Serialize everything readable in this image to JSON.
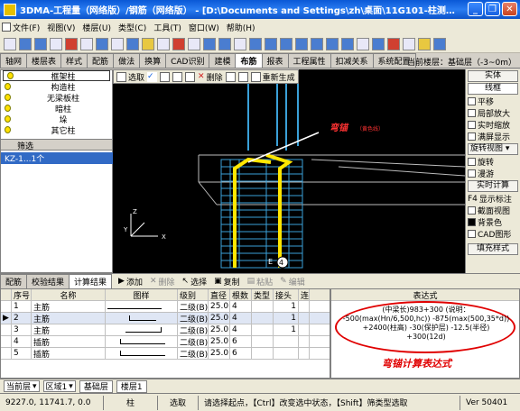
{
  "window": {
    "title": "3DMA-工程量（网络版）/钢筋（网络版） - [D:\\Documents and Settings\\zh\\桌面\\11G101-柱测…"
  },
  "menu": [
    "文件(F)",
    "视图(V)",
    "楼层(U)",
    "类型(C)",
    "工具(T)",
    "窗口(W)",
    "帮助(H)"
  ],
  "tabs": [
    "轴网",
    "楼层表",
    "样式",
    "配筋",
    "做法",
    "换算",
    "CAD识别",
    "建模",
    "布筋",
    "报表",
    "工程属性",
    "扣减关系",
    "系统配置"
  ],
  "active_tab": "布筋",
  "floor_info": "当前楼层：基础层（-3~0m）",
  "left_panel": {
    "tree": [
      "框架柱",
      "构造柱",
      "无梁板柱",
      "暗柱",
      "垛",
      "其它柱"
    ],
    "selected_tree": "框架柱",
    "filter_label": "筛选",
    "list_item": "KZ-1...1个"
  },
  "viewport": {
    "toolbar": {
      "select": "选取",
      "delete": "删除",
      "regenerate": "重新生成"
    },
    "annotation": "弯锚",
    "annotation_sub": "（黄色线）",
    "axis_label": "E",
    "axis_num": "4",
    "axis_x": "X",
    "axis_y": "Y",
    "axis_z": "Z"
  },
  "right_panel": {
    "solid": "实体",
    "wireframe": "线框",
    "items": [
      "平移",
      "局部放大",
      "实时缩放",
      "满屏显示"
    ],
    "rotate_view": "旋转视图",
    "rotate": "旋转",
    "roam": "漫游",
    "realtime_calc": "实时计算",
    "f4": "F4",
    "show_label": "显示标注",
    "section_view": "截面视图",
    "bg_color": "背景色",
    "cad_graph": "CAD图形",
    "fill_style": "填充样式"
  },
  "bottom_tabs": {
    "tabs": [
      "配筋",
      "校验结果",
      "计算结果"
    ],
    "active": "计算结果",
    "add": "添加",
    "delete": "删除",
    "select": "选择",
    "copy": "复制",
    "paste": "粘贴",
    "edit": "编辑"
  },
  "table": {
    "headers": [
      "序号",
      "名称",
      "图样",
      "级别",
      "直径",
      "根数",
      "类型",
      "接头",
      "连"
    ],
    "rows": [
      [
        "1",
        "主筋",
        "",
        "二级(B)",
        "25.0",
        "4",
        "",
        "1"
      ],
      [
        "2",
        "主筋",
        "",
        "二级(B)",
        "25.0",
        "4",
        "",
        "1"
      ],
      [
        "3",
        "主筋",
        "",
        "二级(B)",
        "25.0",
        "4",
        "",
        "1"
      ],
      [
        "4",
        "插筋",
        "",
        "二级(B)",
        "25.0",
        "6",
        "",
        ""
      ],
      [
        "5",
        "插筋",
        "",
        "二级(B)",
        "25.0",
        "6",
        "",
        ""
      ]
    ]
  },
  "formula": {
    "title": "表达式",
    "lines": [
      "(中梁长)983+300 (说明：",
      "-500(max(Hn/6,500,hc)) -875(max(500,35*d))",
      "+2400(柱高) -30(保护层) -12.5(半径)",
      "+300(12d)"
    ],
    "label": "弯锚计算表达式"
  },
  "floorbar": {
    "current_floor": "当前层",
    "area": "区域1",
    "tabs": [
      "基础层",
      "楼层1"
    ]
  },
  "status": {
    "coords": "9227.0, 11741.7, 0.0",
    "type": "柱",
    "mode": "选取",
    "hint": "请选择起点，【Ctrl】改变选中状态，【Shift】筛类型选取",
    "version": "Ver 50401"
  }
}
